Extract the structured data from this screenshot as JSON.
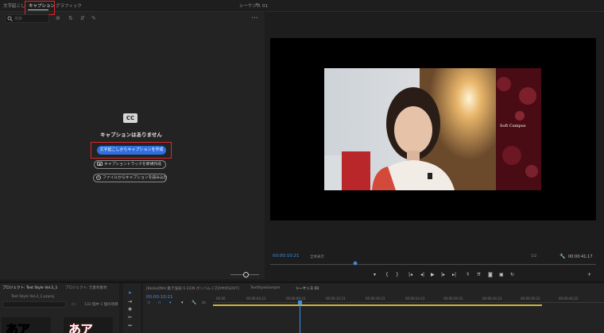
{
  "left_panel": {
    "tabs": [
      "文字起こし",
      "キャプション",
      "グラフィック"
    ],
    "active_tab": "キャプション",
    "search_placeholder": "検索",
    "cc_icon_label": "CC",
    "empty_message": "キャプションはありません",
    "create_from_transcript_label": "文字起こしからキャプションを作成",
    "new_track_label": "キャプショントラックを新規作成",
    "import_from_file_label": "ファイルからキャプションを読み込む",
    "more_label": "•••"
  },
  "monitor": {
    "title": "シーケンス 01",
    "menu_label": "≡",
    "timecode": "00:00:10:21",
    "fit_label": "全体表示",
    "quality_label": "1/2",
    "duration": "00:00:41:17",
    "video_overlay_text": "Soft Campus"
  },
  "bottom": {
    "project_tab": "プロジェクト: Text Style Vol.2_1",
    "project_tab2": "プロジェクト: 元素材素材",
    "project_file": "Text Style Vol.2_1.prproj",
    "project_count": "132 個中 1 個の項目",
    "thumb1_text": "あア",
    "thumb2_text": "あア",
    "timeline_tabs": [
      "[Ballad]Nm 動き強弱 Ⅴ.22(N ボンバムイズの中のSOVT)",
      "TextStyleSample",
      "シーケンス 01"
    ],
    "active_timeline_tab": "シーケンス 01",
    "timeline_timecode": "00:00:10:21",
    "ticks": [
      "00:00",
      "00:00:04:23",
      "00:00:09:23",
      "00:00:14:23",
      "00:00:19:23",
      "00:00:24:23",
      "00:00:29:23",
      "00:00:34:23",
      "00:00:39:23",
      "00:00:44:22"
    ]
  },
  "colors": {
    "accent": "#2d6ee0",
    "highlight": "#e0262c",
    "timecode": "#3d8ee8"
  }
}
